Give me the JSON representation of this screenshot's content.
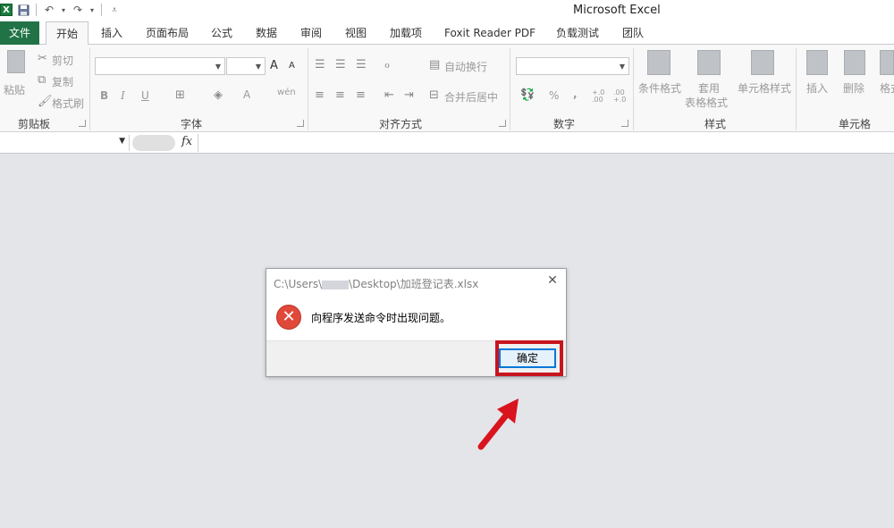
{
  "app": {
    "title": "Microsoft Excel",
    "logo": "X"
  },
  "tabs": [
    "文件",
    "开始",
    "插入",
    "页面布局",
    "公式",
    "数据",
    "审阅",
    "视图",
    "加载项",
    "Foxit Reader PDF",
    "负载测试",
    "团队"
  ],
  "ribbon": {
    "clipboard": {
      "paste": "粘贴",
      "cut": "剪切",
      "copy": "复制",
      "format_painter": "格式刷",
      "label": "剪贴板"
    },
    "font": {
      "label": "字体",
      "bold": "B",
      "italic": "I",
      "underline": "U",
      "grow": "A",
      "shrink": "A",
      "color": "A",
      "phonetic": "wén"
    },
    "alignment": {
      "wrap": "自动换行",
      "merge": "合并后居中",
      "label": "对齐方式"
    },
    "number": {
      "percent": "%",
      "comma": ",",
      "inc_decimal": "+.0 .00",
      "dec_decimal": ".00 +.0",
      "label": "数字"
    },
    "styles": {
      "conditional": "条件格式",
      "table1": "套用",
      "table2": "表格格式",
      "cell": "单元格样式",
      "label": "样式"
    },
    "cells": {
      "insert": "插入",
      "delete": "删除",
      "format": "格式",
      "label": "单元格"
    }
  },
  "formula_bar": {
    "fx": "fx"
  },
  "dialog": {
    "title_prefix": "C:\\Users\\",
    "title_suffix": "\\Desktop\\加班登记表.xlsx",
    "message": "向程序发送命令时出现问题。",
    "ok": "确定",
    "close": "✕"
  },
  "colors": {
    "accent": "#217346",
    "highlight": "#c8141e",
    "error": "#e0483a"
  }
}
